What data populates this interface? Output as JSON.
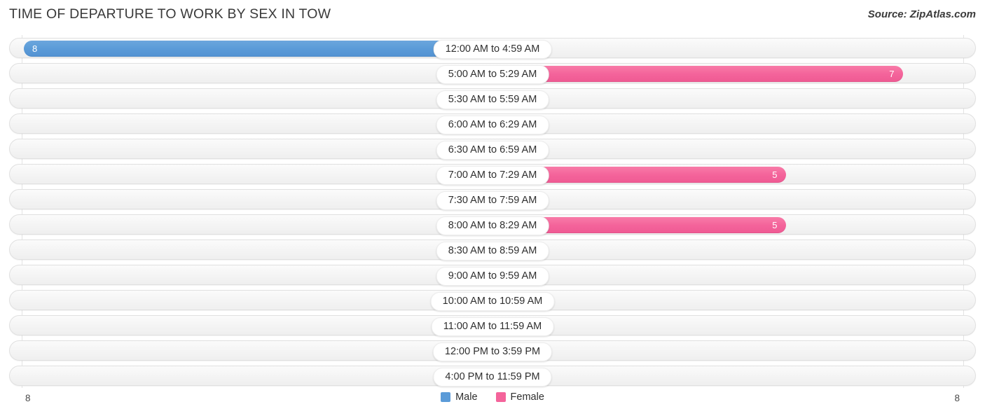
{
  "header": {
    "title": "TIME OF DEPARTURE TO WORK BY SEX IN TOW",
    "source": "Source: ZipAtlas.com"
  },
  "axis": {
    "left_label": "8",
    "right_label": "8"
  },
  "legend": {
    "items": [
      {
        "label": "Male",
        "color": "#5b9bd8"
      },
      {
        "label": "Female",
        "color": "#f4649b"
      }
    ]
  },
  "colors": {
    "male": "#5b9bd8",
    "male_zero": "#aecaea",
    "female": "#f4649b",
    "female_zero": "#f9a8c4",
    "row_background": "#f4f4f4",
    "row_border": "#e0e0e0",
    "gridline": "#e3e3e3"
  },
  "chart_data": {
    "type": "bar",
    "title": "TIME OF DEPARTURE TO WORK BY SEX IN TOW",
    "subtitle": "",
    "xlabel": "",
    "ylabel": "",
    "orientation": "horizontal",
    "style": "diverging-bidirectional",
    "legend_position": "bottom-center",
    "grid": false,
    "xlim": [
      8,
      8
    ],
    "axis_max_left": 8,
    "axis_max_right": 8,
    "categories": [
      "12:00 AM to 4:59 AM",
      "5:00 AM to 5:29 AM",
      "5:30 AM to 5:59 AM",
      "6:00 AM to 6:29 AM",
      "6:30 AM to 6:59 AM",
      "7:00 AM to 7:29 AM",
      "7:30 AM to 7:59 AM",
      "8:00 AM to 8:29 AM",
      "8:30 AM to 8:59 AM",
      "9:00 AM to 9:59 AM",
      "10:00 AM to 10:59 AM",
      "11:00 AM to 11:59 AM",
      "12:00 PM to 3:59 PM",
      "4:00 PM to 11:59 PM"
    ],
    "series": [
      {
        "name": "Male",
        "color": "#5b9bd8",
        "values": [
          8,
          0,
          0,
          0,
          0,
          0,
          0,
          0,
          0,
          0,
          0,
          0,
          0,
          0
        ]
      },
      {
        "name": "Female",
        "color": "#f4649b",
        "values": [
          0,
          7,
          0,
          0,
          0,
          5,
          0,
          5,
          0,
          0,
          0,
          0,
          0,
          0
        ]
      }
    ]
  },
  "rows": [
    {
      "label": "12:00 AM to 4:59 AM",
      "male": "8",
      "female": "0"
    },
    {
      "label": "5:00 AM to 5:29 AM",
      "male": "0",
      "female": "7"
    },
    {
      "label": "5:30 AM to 5:59 AM",
      "male": "0",
      "female": "0"
    },
    {
      "label": "6:00 AM to 6:29 AM",
      "male": "0",
      "female": "0"
    },
    {
      "label": "6:30 AM to 6:59 AM",
      "male": "0",
      "female": "0"
    },
    {
      "label": "7:00 AM to 7:29 AM",
      "male": "0",
      "female": "5"
    },
    {
      "label": "7:30 AM to 7:59 AM",
      "male": "0",
      "female": "0"
    },
    {
      "label": "8:00 AM to 8:29 AM",
      "male": "0",
      "female": "5"
    },
    {
      "label": "8:30 AM to 8:59 AM",
      "male": "0",
      "female": "0"
    },
    {
      "label": "9:00 AM to 9:59 AM",
      "male": "0",
      "female": "0"
    },
    {
      "label": "10:00 AM to 10:59 AM",
      "male": "0",
      "female": "0"
    },
    {
      "label": "11:00 AM to 11:59 AM",
      "male": "0",
      "female": "0"
    },
    {
      "label": "12:00 PM to 3:59 PM",
      "male": "0",
      "female": "0"
    },
    {
      "label": "4:00 PM to 11:59 PM",
      "male": "0",
      "female": "0"
    }
  ]
}
